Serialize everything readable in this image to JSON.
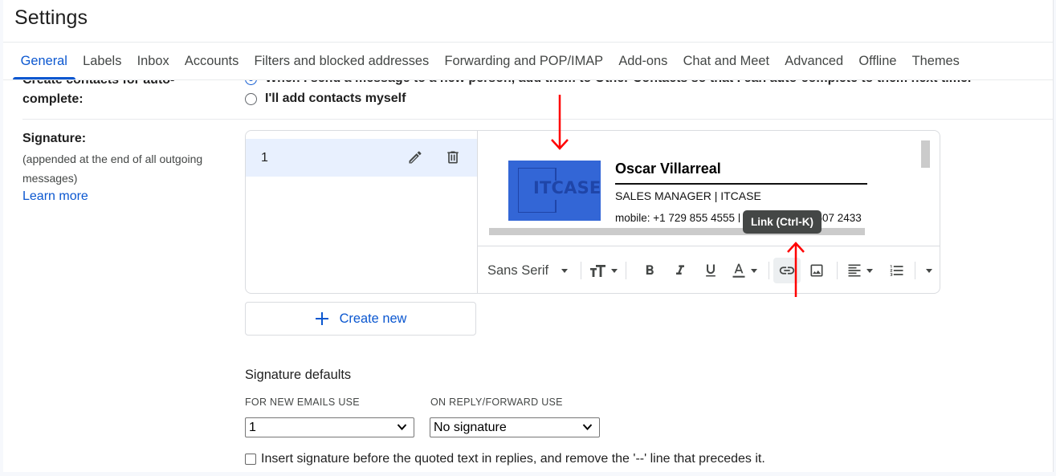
{
  "header": {
    "title": "Settings"
  },
  "tabs": [
    {
      "label": "General",
      "active": true
    },
    {
      "label": "Labels"
    },
    {
      "label": "Inbox"
    },
    {
      "label": "Accounts"
    },
    {
      "label": "Filters and blocked addresses"
    },
    {
      "label": "Forwarding and POP/IMAP"
    },
    {
      "label": "Add-ons"
    },
    {
      "label": "Chat and Meet"
    },
    {
      "label": "Advanced"
    },
    {
      "label": "Offline"
    },
    {
      "label": "Themes"
    }
  ],
  "contacts": {
    "label": "Create contacts for auto-complete:",
    "options": [
      {
        "label": "When I send a message to a new person, add them to Other Contacts so that I can auto-complete to them next time.",
        "checked": true
      },
      {
        "label": "I'll add contacts myself",
        "checked": false
      }
    ]
  },
  "signature": {
    "label": "Signature:",
    "description": "(appended at the end of all outgoing messages)",
    "learn_more": "Learn more",
    "list": [
      {
        "name": "1",
        "selected": true
      }
    ],
    "editor": {
      "logo_text": "ITCASE",
      "name": "Oscar Villarreal",
      "title_line": "SALES MANAGER |  ITCASE",
      "contact_line": "mobile: +1 729 855 4555 | phone: +1 728 607 2433"
    },
    "toolbar": {
      "font": "Sans Serif",
      "items": [
        "font-size",
        "bold",
        "italic",
        "underline",
        "text-color",
        "link",
        "insert-image",
        "align",
        "numbered-list",
        "more-formatting"
      ]
    },
    "tooltip": "Link (Ctrl-K)",
    "create_new": "Create new"
  },
  "defaults": {
    "title": "Signature defaults",
    "new_emails_label": "FOR NEW EMAILS USE",
    "new_emails_value": "1",
    "reply_label": "ON REPLY/FORWARD USE",
    "reply_value": "No signature",
    "insert_before_label": "Insert signature before the quoted text in replies, and remove the '--' line that precedes it.",
    "insert_before_checked": false
  },
  "annotations": {
    "arrow_color": "#ff0000"
  },
  "colors": {
    "accent": "#0b57d0",
    "selected_row": "#e8f0fe",
    "logo_bg": "#3366d6",
    "tooltip_bg": "#444746"
  }
}
